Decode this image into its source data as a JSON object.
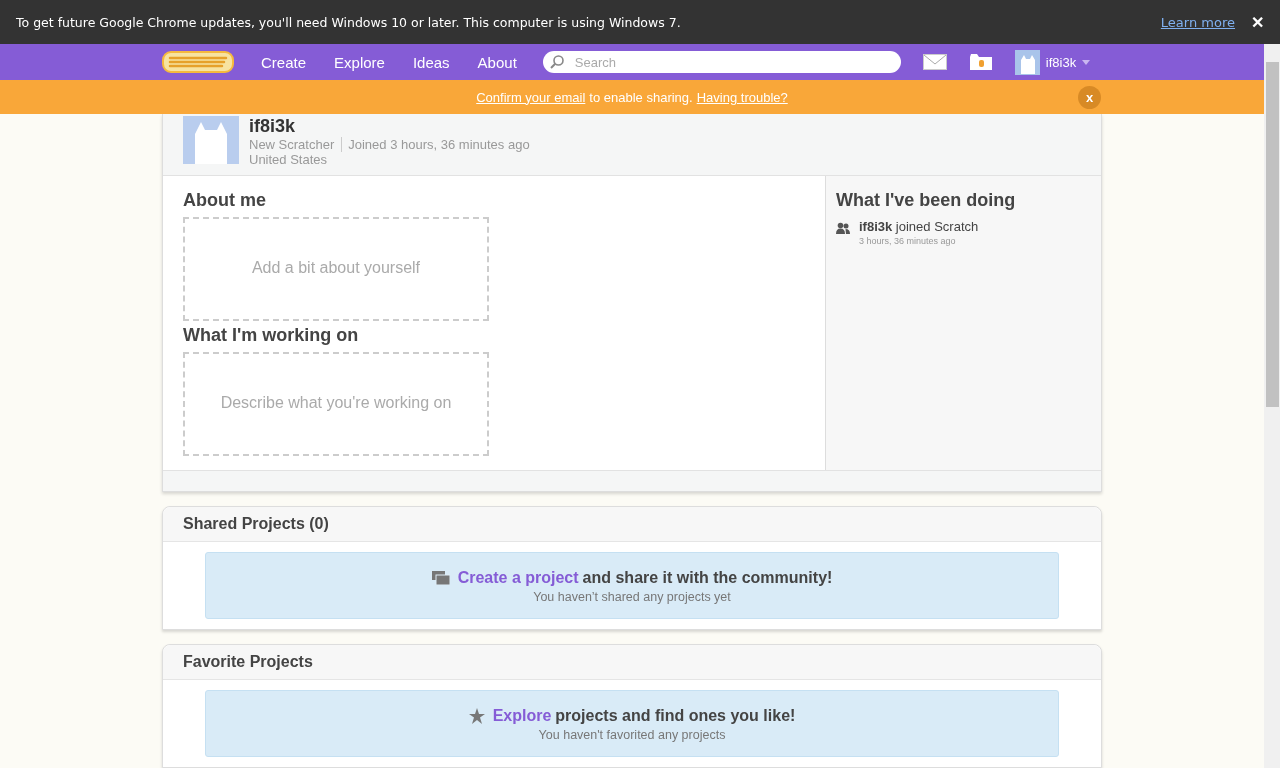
{
  "browser_notice": {
    "message": "To get future Google Chrome updates, you'll need Windows 10 or later. This computer is using Windows 7.",
    "link": "Learn more",
    "close": "✕"
  },
  "nav": {
    "items": [
      "Create",
      "Explore",
      "Ideas",
      "About"
    ],
    "search": {
      "placeholder": "Search"
    },
    "username": "if8i3k"
  },
  "email_banner": {
    "link": "Confirm your email",
    "text": "to enable sharing.",
    "help_link": "Having trouble?",
    "close": "x"
  },
  "profile": {
    "username": "if8i3k",
    "status": "New Scratcher",
    "joined": "Joined 3 hours, 36 minutes ago",
    "location": "United States"
  },
  "about_me": {
    "title": "About me",
    "placeholder": "Add a bit about yourself"
  },
  "working_on": {
    "title": "What I'm working on",
    "placeholder": "Describe what you're working on"
  },
  "activity": {
    "title": "What I've been doing",
    "items": [
      {
        "text": "**if8i3k** joined Scratch",
        "time": "3 hours, 36 minutes ago"
      }
    ]
  },
  "sections": [
    {
      "title": "Shared Projects (0)",
      "kind": "create",
      "link": "Create a project",
      "text": "and share it with the community!",
      "note": "You haven’t shared any projects yet"
    },
    {
      "title": "Favorite Projects",
      "kind": "explore",
      "link": "Explore",
      "text": "projects and find ones you like!",
      "note": "You haven't favorited any projects"
    }
  ]
}
